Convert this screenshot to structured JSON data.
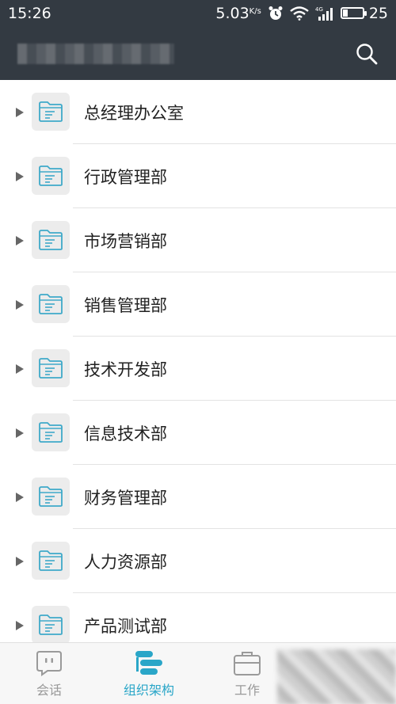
{
  "status_bar": {
    "time": "15:26",
    "net_speed": "5.03",
    "net_unit": "K/s",
    "battery_level": "25",
    "battery_fraction": 0.25,
    "icons": [
      "alarm-icon",
      "wifi-icon",
      "signal-4g-icon",
      "battery-icon"
    ]
  },
  "header": {
    "title": "",
    "search_icon": "search-icon"
  },
  "departments": [
    {
      "label": "总经理办公室"
    },
    {
      "label": "行政管理部"
    },
    {
      "label": "市场营销部"
    },
    {
      "label": "销售管理部"
    },
    {
      "label": "技术开发部"
    },
    {
      "label": "信息技术部"
    },
    {
      "label": "财务管理部"
    },
    {
      "label": "人力资源部"
    },
    {
      "label": "产品测试部"
    }
  ],
  "bottom_nav": {
    "tabs": [
      {
        "label": "会话",
        "icon": "chat-bubble-icon",
        "active": false
      },
      {
        "label": "组织架构",
        "icon": "org-structure-icon",
        "active": true
      },
      {
        "label": "工作",
        "icon": "briefcase-icon",
        "active": false
      }
    ]
  },
  "colors": {
    "header_bg": "#333a42",
    "accent": "#2aa6c8",
    "inactive_tab": "#999999"
  }
}
